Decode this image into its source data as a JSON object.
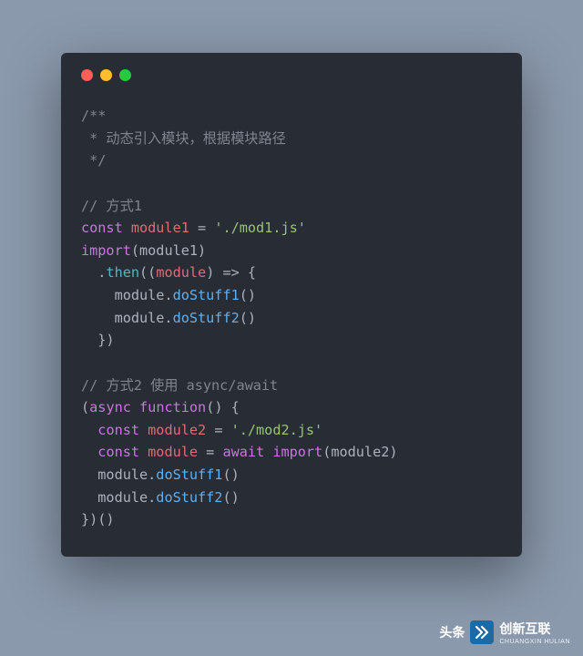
{
  "code": {
    "l1": "/**",
    "l2": " * 动态引入模块，根据模块路径",
    "l3": " */",
    "l5": "// 方式1",
    "l6_const": "const",
    "l6_var": " module1 ",
    "l6_eq": "= ",
    "l6_str": "'./mod1.js'",
    "l7_import": "import",
    "l7_rest": "(module1)",
    "l8_pre": "  .",
    "l8_then": "then",
    "l8_rest": "((",
    "l8_param": "module",
    "l8_arrow": ") => {",
    "l9": "    module.",
    "l9_fn": "doStuff1",
    "l9_end": "()",
    "l10": "    module.",
    "l10_fn": "doStuff2",
    "l10_end": "()",
    "l11": "  })",
    "l13": "// 方式2 使用 async/await",
    "l14_open": "(",
    "l14_async": "async",
    "l14_sp": " ",
    "l14_func": "function",
    "l14_rest": "() {",
    "l15_pre": "  ",
    "l15_const": "const",
    "l15_var": " module2 ",
    "l15_eq": "= ",
    "l15_str": "'./mod2.js'",
    "l16_pre": "  ",
    "l16_const": "const",
    "l16_var": " module ",
    "l16_eq": "= ",
    "l16_await": "await",
    "l16_sp": " ",
    "l16_import": "import",
    "l16_rest": "(module2)",
    "l17": "  module.",
    "l17_fn": "doStuff1",
    "l17_end": "()",
    "l18": "  module.",
    "l18_fn": "doStuff2",
    "l18_end": "()",
    "l19": "})()"
  },
  "footer": {
    "prefix": "头条",
    "brand": "创新互联",
    "sub": "CHUANGXIN HULIAN"
  }
}
